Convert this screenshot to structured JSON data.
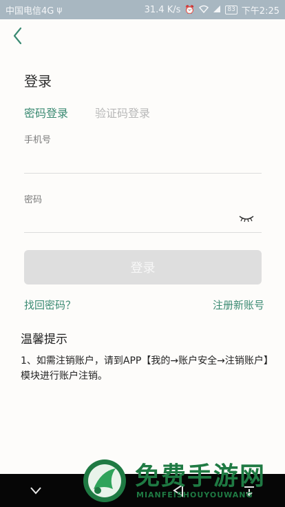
{
  "status_bar": {
    "carrier": "中国电信4G",
    "speed": "31.4 K/s",
    "battery": "83",
    "time": "下午2:25",
    "icons": [
      "usb-icon",
      "alarm-icon",
      "wifi-icon",
      "signal-icon"
    ]
  },
  "header": {
    "back_icon": "chevron-left-icon"
  },
  "page_title": "登录",
  "tabs": [
    {
      "label": "密码登录",
      "active": true
    },
    {
      "label": "验证码登录",
      "active": false
    }
  ],
  "form": {
    "phone_label": "手机号",
    "phone_value": "",
    "password_label": "密码",
    "password_value": "",
    "eye_icon": "eye-closed-icon",
    "submit_label": "登录"
  },
  "links": {
    "forgot": "找回密码？",
    "register": "注册新账号"
  },
  "tips": {
    "title": "温馨提示",
    "body": "1、如需注销账户，请到APP【我的→账户安全→注销账户】模块进行账户注销。"
  },
  "watermark": {
    "title": "免费手游网",
    "subtitle": "MIANFEISHOUYOUWANG"
  },
  "nav_bar": {
    "icons": [
      "collapse-icon",
      "back-nav-icon",
      "home-icon",
      "recents-icon"
    ]
  },
  "colors": {
    "accent": "#3a8a72",
    "status_bar": "#a8b7c1",
    "button_disabled": "#dedede"
  }
}
